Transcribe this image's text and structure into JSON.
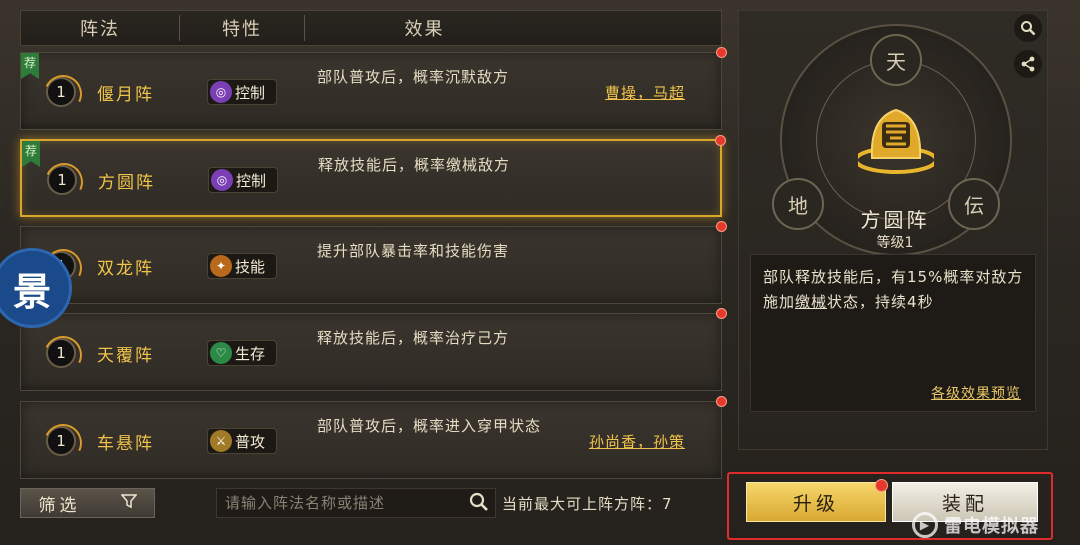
{
  "header": {
    "col_formation": "阵法",
    "col_trait": "特性",
    "col_effect": "效果"
  },
  "rows": [
    {
      "recommended": true,
      "rec_label": "荐",
      "level": "1",
      "name": "偃月阵",
      "trait": "控制",
      "trait_type": "control",
      "effect": "部队普攻后，概率沉默敌方",
      "heroes": "曹操，马超",
      "red_dot": true,
      "selected": false
    },
    {
      "recommended": true,
      "rec_label": "荐",
      "level": "1",
      "name": "方圆阵",
      "trait": "控制",
      "trait_type": "control",
      "effect": "释放技能后，概率缴械敌方",
      "heroes": "",
      "red_dot": true,
      "selected": true
    },
    {
      "recommended": false,
      "rec_label": "",
      "level": "1",
      "name": "双龙阵",
      "trait": "技能",
      "trait_type": "skill",
      "effect": "提升部队暴击率和技能伤害",
      "heroes": "",
      "red_dot": true,
      "selected": false
    },
    {
      "recommended": false,
      "rec_label": "",
      "level": "1",
      "name": "天覆阵",
      "trait": "生存",
      "trait_type": "survive",
      "effect": "释放技能后，概率治疗己方",
      "heroes": "",
      "red_dot": true,
      "selected": false
    },
    {
      "recommended": false,
      "rec_label": "",
      "level": "1",
      "name": "车悬阵",
      "trait": "普攻",
      "trait_type": "attack",
      "effect": "部队普攻后，概率进入穿甲状态",
      "heroes": "孙尚香，孙策",
      "red_dot": true,
      "selected": false
    }
  ],
  "floating_button": {
    "label": "景"
  },
  "bottom": {
    "filter_label": "筛选",
    "search_placeholder": "请输入阵法名称或描述",
    "max_formations_text": "当前最大可上阵方阵：7"
  },
  "detail": {
    "glyph_top": "天",
    "glyph_left": "地",
    "glyph_right": "伝",
    "title": "方圆阵",
    "level_text": "等级1",
    "description_before": "部队释放技能后，有15%概率对敌方施加",
    "description_keyword": "缴械",
    "description_after": "状态，持续4秒",
    "preview_link": "各级效果预览"
  },
  "actions": {
    "upgrade_label": "升级",
    "equip_label": "装配"
  },
  "watermark": {
    "text": "雷电模拟器"
  },
  "colors": {
    "accent_gold": "#f0c34a",
    "selected_border": "#d8a72c",
    "red_dot": "#e53a2b",
    "highlight_frame": "#e02b2b"
  }
}
